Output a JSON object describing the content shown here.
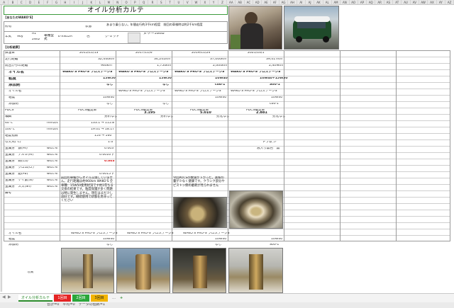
{
  "sheet_title": "オイル分析カルテ",
  "section_customer": "【あなたのWAKO'S】",
  "section_results": "【分析結果】",
  "owner_label": "所有",
  "year_label": "年式",
  "year_value": "96y",
  "engine_value": "A1",
  "drive_value": "2WD",
  "model_label": "車種型式",
  "model_value": "E-XN12A",
  "color_label": "色",
  "color_value": "グ-ミッド",
  "usage_label": "状態",
  "usage_note": "あまり乗らない。年間走行約3千km程度　前回の車検時は約2千km程度",
  "interval_note": "ヌ-ドー10kkb",
  "row_labels": {
    "date": "採油日",
    "total_km": "走行距離",
    "since_change": "前回からの距離",
    "oil_name": "オイル名",
    "viscosity": "粘度",
    "additive": "添加剤",
    "oil_name2": "オイル名",
    "visc2": "粘度",
    "additive2": "添加剤",
    "pdcs": "PDCS",
    "item": "項目",
    "unit_label": "単位",
    "v40": "40℃",
    "v100": "100℃",
    "vi": "粘度指数",
    "flash": "引火点(℃)",
    "metal_fe": "金属分　鉄(Fe)",
    "metal_al": "金属分　アルミ(Al)",
    "metal_cu": "金属分　銅(Cu)",
    "metal_cr": "金属分　クロム(Cr)",
    "metal_pb": "金属分　鉛(Pb)",
    "metal_si": "金属分　ケイ素(Si)",
    "metal_sn": "金属分　スズ(Sn)",
    "remarks": "備考",
    "photos": "写真"
  },
  "mid_values": {
    "oil_name": "WAKO'S PRO-S プロステージS",
    "viscosity_a": "15W50",
    "viscosity_b": "10W40",
    "viscosity_c": "10W40+15W50",
    "additive_none": "なし",
    "additive_cod": "cod-1",
    "additive_s": "S00-1",
    "unit_mm2": "mm2/s",
    "unit_wt": "wtcc%",
    "pdcs_label": "PDCS推奨率",
    "pdcs_v1": "3.195",
    "pdcs_v2": "5.010",
    "pdcs_v3": "2.881",
    "judge_ok": "分析なし",
    "judge_low": "劣化なし",
    "v40_val": "133.1 → 115.8",
    "v100_val": "19.01 → 18.17",
    "vi_val": "153 → 160",
    "flash_val": "1.0",
    "fe_val": "0.003",
    "al_val": "0.0016下",
    "cu_val": "0.003",
    "ss_val": "0.0015下"
  },
  "dates": [
    "2015/11/13",
    "2017/11/6",
    "2019/11/24",
    "2021/10/1"
  ],
  "totals": [
    "32,440km",
    "34,241km",
    "37,000km",
    "39,417km"
  ],
  "since": [
    "960km",
    "1,750km",
    "2,000km",
    "2,409km"
  ],
  "remarks_1": "前回の車検からオイル交換していません。走行距離は約960km WAKO'S 全車種：15W50使用状況です約1年ちる交換の結果です。粘度保護が多く問題は特に発生しません。現在はまだ少し良好です。継続使用で状態を見守ってください",
  "remarks_2": "今回PDCSの数値が下がった。鉄粉の量が少なく健康です。クランク部分やピストン側の磨耗が見られません",
  "side_note_1": "ドブ状 少",
  "side_note_2": "液入り無色　無",
  "tabs": {
    "active": "オイル分析カルテ",
    "t1": "1回目",
    "t2": "2回目",
    "t3": "3回目",
    "more": "…",
    "add": "+"
  },
  "status_bar": "合計=0　平均=0　データの個数=1",
  "colors": {
    "tab_active_text": "#2a8a2a",
    "tab1": "#e52424",
    "tab2": "#2aa63a",
    "tab3": "#f2b400",
    "title_border": "#3d9a3d"
  },
  "col_letters": [
    "A",
    "B",
    "C",
    "D",
    "E",
    "F",
    "G",
    "H",
    "I",
    "J",
    "K",
    "L",
    "M",
    "N",
    "O",
    "P",
    "Q",
    "R",
    "S",
    "T",
    "U",
    "V",
    "W",
    "X",
    "Y",
    "Z",
    "AA",
    "AB",
    "AC",
    "AD",
    "AE",
    "AF",
    "AG",
    "AH",
    "AI",
    "AJ",
    "AK",
    "AL",
    "AM",
    "AN",
    "AO",
    "AP",
    "AQ",
    "AR",
    "AS",
    "AT",
    "AU",
    "AV",
    "AW",
    "AX",
    "AY",
    "AZ"
  ]
}
